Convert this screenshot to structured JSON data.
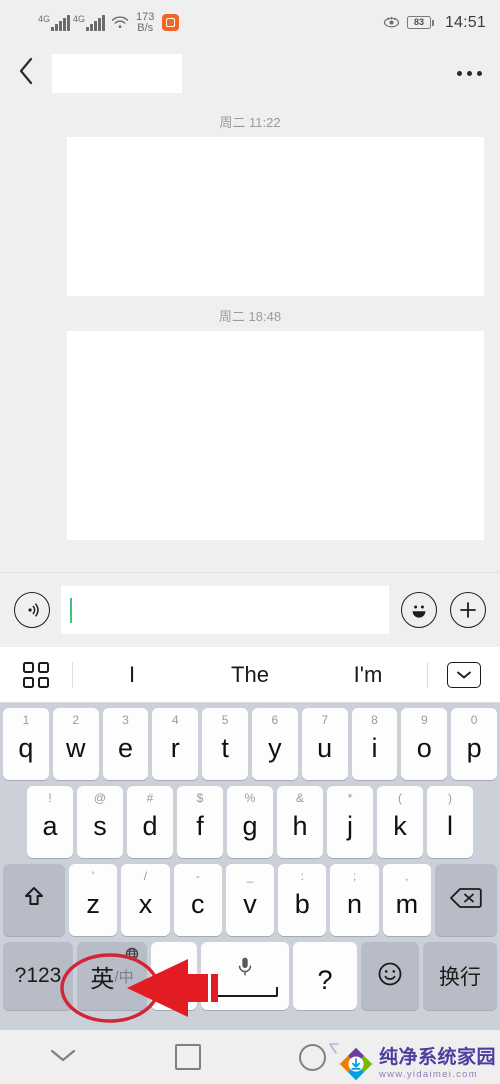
{
  "status_bar": {
    "network_type_1": "4G",
    "network_type_2": "4G",
    "net_speed_value": "173",
    "net_speed_unit": "B/s",
    "battery_percent": "83",
    "clock": "14:51",
    "icons": [
      "signal-icon",
      "signal-icon",
      "wifi-icon",
      "app-icon",
      "eye-icon",
      "battery-icon"
    ]
  },
  "title_bar": {
    "back_label": "back-chevron",
    "title": "",
    "more_label": "more-options"
  },
  "conversation": {
    "messages": [
      {
        "timestamp": "周二 11:22",
        "body": ""
      },
      {
        "timestamp": "周二 18:48",
        "body": ""
      }
    ]
  },
  "input_bar": {
    "voice_icon": "voice-input-icon",
    "text_value": "",
    "placeholder": "",
    "emoji_icon": "emoji-icon",
    "plus_icon": "plus-icon"
  },
  "suggestion_bar": {
    "grid_icon": "apps-grid-icon",
    "suggestions": [
      "I",
      "The",
      "I'm"
    ],
    "collapse_icon": "chevron-down-box-icon"
  },
  "keyboard": {
    "row1": [
      {
        "letter": "q",
        "sup": "1"
      },
      {
        "letter": "w",
        "sup": "2"
      },
      {
        "letter": "e",
        "sup": "3"
      },
      {
        "letter": "r",
        "sup": "4"
      },
      {
        "letter": "t",
        "sup": "5"
      },
      {
        "letter": "y",
        "sup": "6"
      },
      {
        "letter": "u",
        "sup": "7"
      },
      {
        "letter": "i",
        "sup": "8"
      },
      {
        "letter": "o",
        "sup": "9"
      },
      {
        "letter": "p",
        "sup": "0"
      }
    ],
    "row2": [
      {
        "letter": "a",
        "sup": "!"
      },
      {
        "letter": "s",
        "sup": "@"
      },
      {
        "letter": "d",
        "sup": "#"
      },
      {
        "letter": "f",
        "sup": "$"
      },
      {
        "letter": "g",
        "sup": "%"
      },
      {
        "letter": "h",
        "sup": "&"
      },
      {
        "letter": "j",
        "sup": "*"
      },
      {
        "letter": "k",
        "sup": "("
      },
      {
        "letter": "l",
        "sup": ")"
      }
    ],
    "row3": {
      "shift": "shift-icon",
      "keys": [
        {
          "letter": "z",
          "sup": "'"
        },
        {
          "letter": "x",
          "sup": "/"
        },
        {
          "letter": "c",
          "sup": "-"
        },
        {
          "letter": "v",
          "sup": "_"
        },
        {
          "letter": "b",
          "sup": ":"
        },
        {
          "letter": "n",
          "sup": ";"
        },
        {
          "letter": "m",
          "sup": ","
        }
      ],
      "delete": "backspace-icon"
    },
    "row4": {
      "numeric": "?123",
      "language_main": "英",
      "language_sub": "/中",
      "language_globe": "globe-icon",
      "blank_key": "",
      "space_icon": "microphone-icon",
      "question": "?",
      "emoji": "smiley-icon",
      "enter": "换行"
    }
  },
  "annotation": {
    "highlight_shape": "red-ellipse",
    "highlight_color": "#d32535",
    "arrow": "red-left-arrow",
    "target": "语言切换键"
  },
  "nav_bar": {
    "items": [
      "chevron-down-icon",
      "square-recents-icon",
      "circle-home-icon"
    ]
  },
  "watermark": {
    "site_name": "纯净系统家园",
    "site_url": "www.yidaimei.com"
  }
}
